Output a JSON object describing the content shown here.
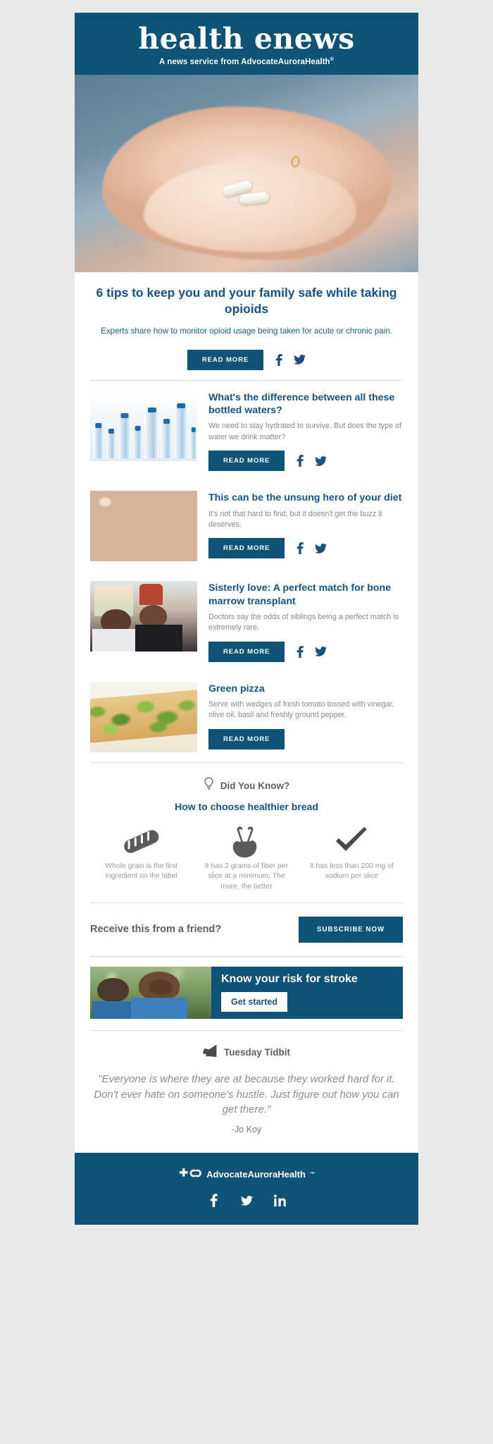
{
  "masthead": {
    "title": "health enews",
    "subtitle_prefix": "A news service from ",
    "brand": "AdvocateAuroraHealth",
    "tm": "®"
  },
  "hero": {
    "alt_name": "hand-holding-pills-photo"
  },
  "feature": {
    "title": "6 tips to keep you and your family safe while taking opioids",
    "description": "Experts share how to monitor opioid usage being taken for acute or chronic pain.",
    "read_more": "READ MORE",
    "facebook_icon": "facebook-icon",
    "twitter_icon": "twitter-icon"
  },
  "articles": [
    {
      "title": "What's the difference between all these bottled waters?",
      "description": "We need to stay hydrated to survive. But does the type of water we drink matter?",
      "read_more": "READ MORE",
      "thumb": "bottled-water-photo",
      "has_social": true
    },
    {
      "title": "This can be the unsung hero of your diet",
      "description": "It's not that hard to find, but it doesn't get the buzz it deserves.",
      "read_more": "READ MORE",
      "thumb": "black-eyed-peas-photo",
      "has_social": true
    },
    {
      "title": "Sisterly love: A perfect match for bone marrow transplant",
      "description": "Doctors say the odds of siblings being a perfect match is extremely rare.",
      "read_more": "READ MORE",
      "thumb": "two-sisters-photo",
      "has_social": true
    },
    {
      "title": "Green pizza",
      "description": "Serve with wedges of fresh tomato tossed with vinegar, olive oil, basil and freshly ground pepper.",
      "read_more": "READ MORE",
      "thumb": "green-pizza-photo",
      "has_social": false
    }
  ],
  "did_you_know": {
    "label": "Did You Know?",
    "icon": "lightbulb-icon",
    "title": "How to choose healthier bread",
    "facts": [
      {
        "icon": "bread-loaf-icon",
        "text": "Whole grain is the first ingredient on the label"
      },
      {
        "icon": "peace-hand-icon",
        "text": "It has 2 grams of fiber per slice at a minimum. The more, the better"
      },
      {
        "icon": "checkmark-icon",
        "text": "It has less than 200 mg of sodium per slice"
      }
    ]
  },
  "subscribe": {
    "text": "Receive this from a friend?",
    "button": "SUBSCRIBE NOW"
  },
  "promo": {
    "title": "Know your risk for stroke",
    "button": "Get started",
    "image": "smiling-women-outdoors-photo"
  },
  "tidbit": {
    "label": "Tuesday Tidbit",
    "icon": "megaphone-icon",
    "quote": "\"Everyone is where they are at because they worked hard for it. Don't ever hate on someone's hustle. Just figure out how you can get there.\"",
    "author": "-Jo Koy"
  },
  "footer": {
    "brand": "AdvocateAuroraHealth",
    "tm": "™",
    "logo_icon": "advocate-aurora-logo-icon",
    "social": [
      {
        "icon": "facebook-icon",
        "name": "facebook-link"
      },
      {
        "icon": "twitter-icon",
        "name": "twitter-link"
      },
      {
        "icon": "linkedin-icon",
        "name": "linkedin-link"
      }
    ]
  },
  "colors": {
    "brand_blue": "#0d5377",
    "link_blue": "#15548a",
    "body_gray": "#8a8a8a",
    "page_bg": "#e9e9e9"
  }
}
